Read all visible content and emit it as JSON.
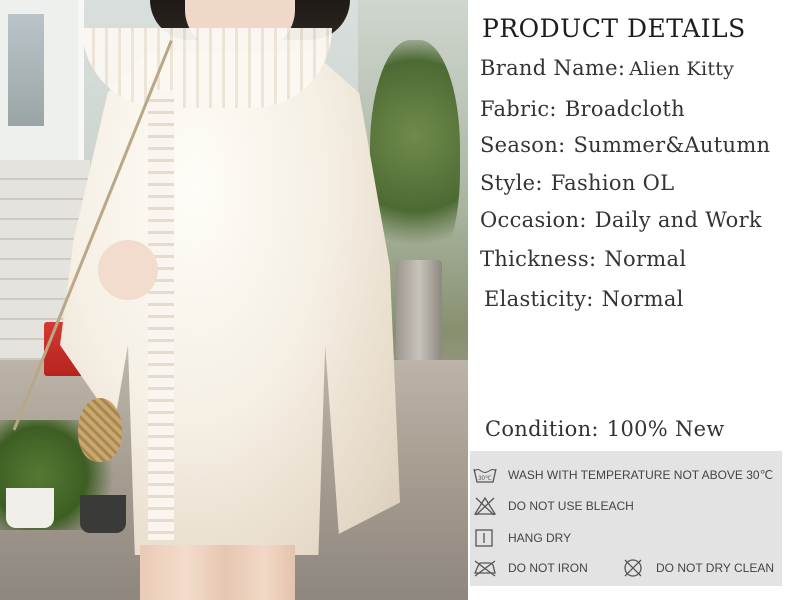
{
  "product": {
    "title": "PRODUCT DETAILS",
    "specs": [
      {
        "label": "Brand Name:",
        "value": "Alien Kitty"
      },
      {
        "label": "Fabric:",
        "value": "Broadcloth"
      },
      {
        "label": "Season:",
        "value": "Summer&Autumn"
      },
      {
        "label": "Style:",
        "value": "Fashion OL"
      },
      {
        "label": "Occasion:",
        "value": "Daily and Work"
      },
      {
        "label": "Thickness:",
        "value": "Normal"
      },
      {
        "label": "Elasticity:",
        "value": "Normal"
      }
    ],
    "condition": {
      "label": "Condition:",
      "value": "100% New"
    }
  },
  "care": {
    "items": [
      {
        "icon": "wash-30-icon",
        "text": "WASH WITH TEMPERATURE NOT ABOVE 30℃"
      },
      {
        "icon": "no-bleach-icon",
        "text": "DO NOT USE BLEACH"
      },
      {
        "icon": "hang-dry-icon",
        "text": "HANG DRY"
      },
      {
        "icon": "no-iron-icon",
        "text": "DO NOT IRON"
      },
      {
        "icon": "no-dry-clean-icon",
        "text": "DO NOT DRY CLEAN"
      }
    ],
    "icon_wash_temp": "30℃"
  },
  "colors": {
    "care_bg": "#e3e3e3",
    "text": "#333333"
  }
}
